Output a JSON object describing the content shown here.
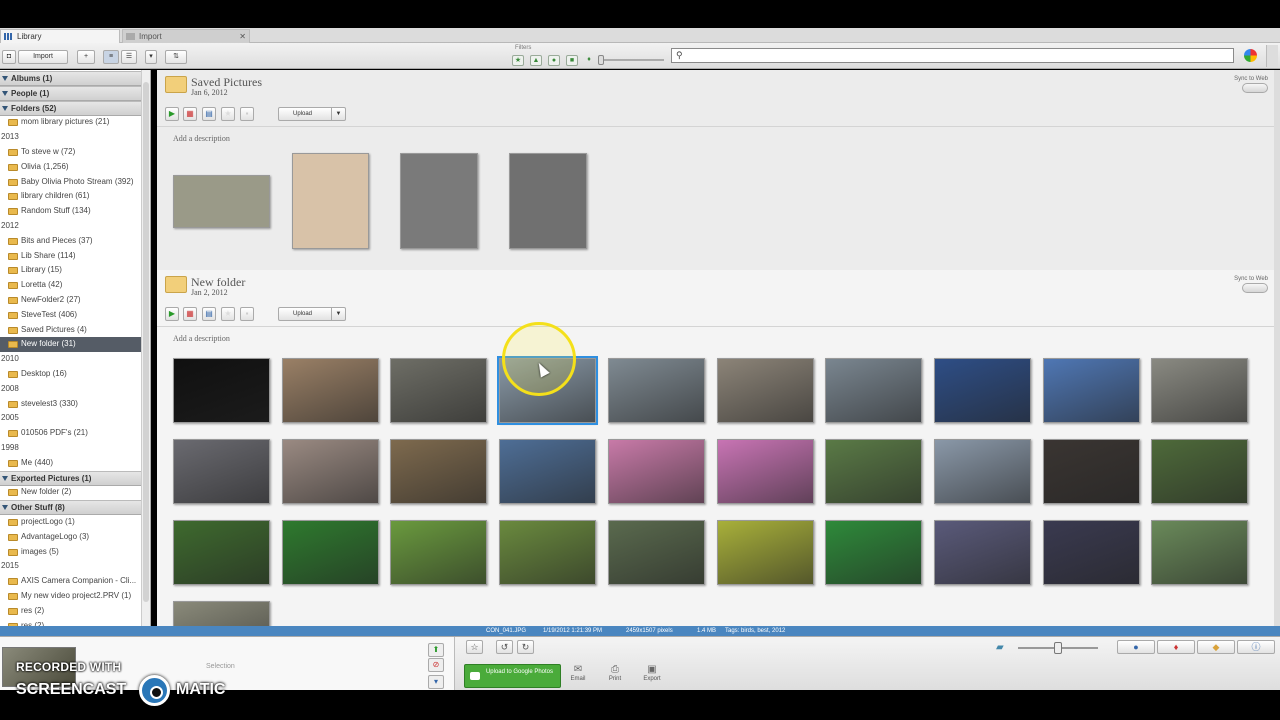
{
  "tabs": [
    {
      "label": "Library"
    },
    {
      "label": "Import"
    }
  ],
  "toolbar": {
    "import_label": "Import",
    "filters_label": "Filters",
    "search_placeholder": ""
  },
  "sidebar": {
    "rows": [
      {
        "kind": "head",
        "label": "Albums (1)"
      },
      {
        "kind": "head",
        "label": "People (1)"
      },
      {
        "kind": "head",
        "label": "Folders (52)"
      },
      {
        "kind": "item",
        "label": "mom library pictures (21)"
      },
      {
        "kind": "year",
        "label": "2013"
      },
      {
        "kind": "item",
        "label": "To steve w (72)"
      },
      {
        "kind": "item",
        "label": "Olivia (1,256)"
      },
      {
        "kind": "item",
        "label": "Baby Olivia Photo Stream (392)"
      },
      {
        "kind": "item",
        "label": "library children (61)"
      },
      {
        "kind": "item",
        "label": "Random Stuff (134)"
      },
      {
        "kind": "year",
        "label": "2012"
      },
      {
        "kind": "item",
        "label": "Bits and Pieces (37)"
      },
      {
        "kind": "item",
        "label": "Lib Share (114)"
      },
      {
        "kind": "item",
        "label": "Library (15)"
      },
      {
        "kind": "item",
        "label": "Loretta (42)"
      },
      {
        "kind": "item",
        "label": "NewFolder2 (27)"
      },
      {
        "kind": "item",
        "label": "SteveTest (406)"
      },
      {
        "kind": "item",
        "label": "Saved Pictures (4)"
      },
      {
        "kind": "item",
        "label": "New folder (31)",
        "selected": true
      },
      {
        "kind": "year",
        "label": "2010"
      },
      {
        "kind": "item",
        "label": "Desktop (16)"
      },
      {
        "kind": "year",
        "label": "2008"
      },
      {
        "kind": "item",
        "label": "stevelest3 (330)"
      },
      {
        "kind": "year",
        "label": "2005"
      },
      {
        "kind": "item",
        "label": "010506 PDF's (21)"
      },
      {
        "kind": "year",
        "label": "1998"
      },
      {
        "kind": "item",
        "label": "Me (440)"
      },
      {
        "kind": "head",
        "label": "Exported Pictures (1)"
      },
      {
        "kind": "item",
        "label": "New folder (2)"
      },
      {
        "kind": "head",
        "label": "Other Stuff (8)"
      },
      {
        "kind": "item",
        "label": "projectLogo (1)"
      },
      {
        "kind": "item",
        "label": "AdvantageLogo (3)"
      },
      {
        "kind": "item",
        "label": "images (5)"
      },
      {
        "kind": "year",
        "label": "2015"
      },
      {
        "kind": "item",
        "label": "AXIS Camera Companion - Cli..."
      },
      {
        "kind": "item",
        "label": "My new video project2.PRV (1)"
      },
      {
        "kind": "item",
        "label": "res (2)"
      },
      {
        "kind": "item",
        "label": "res (2)"
      }
    ]
  },
  "folders": [
    {
      "title": "Saved Pictures",
      "date": "Jan 6, 2012",
      "sync_label": "Sync to Web",
      "upload_label": "Upload",
      "description_placeholder": "Add a description",
      "thumb_colors": [
        "#9a9a88",
        "#d8c2a8",
        "#7a7a7a",
        "#707070"
      ]
    },
    {
      "title": "New folder",
      "date": "Jan 2, 2012",
      "sync_label": "Sync to Web",
      "upload_label": "Upload",
      "description_placeholder": "Add a description",
      "thumb_colors": [
        "#101010",
        "#9a8066",
        "#6e6e66",
        "#8a9aa8",
        "#7f8a92",
        "#8c8478",
        "#7a8690",
        "#2e4e86",
        "#4f77b4",
        "#8a8a82",
        "#6a6a70",
        "#9a8a82",
        "#7e6a4e",
        "#4e6e96",
        "#c87aa8",
        "#c874b4",
        "#5a7a46",
        "#8a98a8",
        "#3a3532",
        "#4e6a3a",
        "#3e6a2e",
        "#2e7a2e",
        "#6a9a3e",
        "#6a8a3e",
        "#5a6a4e",
        "#a8b03a",
        "#2e8a3a",
        "#5a5a7a",
        "#3a3a50",
        "#6a8a5a",
        "#8a8a7a"
      ],
      "selected_index": 3
    }
  ],
  "status": {
    "filename": "CON_041.JPG",
    "datetime": "1/19/2012 1:21:39 PM",
    "dimensions": "2459x1507 pixels",
    "size": "1.4 MB",
    "tags": "Tags: birds, best, 2012"
  },
  "tray": {
    "selection_label": "Selection",
    "google_label": "Upload to Google Photos",
    "email_label": "Email",
    "print_label": "Print",
    "export_label": "Export"
  },
  "watermark": {
    "line1": "RECORDED WITH",
    "line2a": "SCREENCAST",
    "line2b": "MATIC"
  },
  "colors": {
    "accent": "#4a86c0",
    "selection": "#2f8fe0",
    "google_green": "#4aab3a"
  }
}
